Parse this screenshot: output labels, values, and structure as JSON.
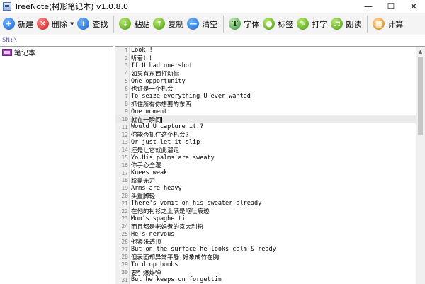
{
  "window": {
    "title": "TreeNote(树形笔记本) v1.0.8.0"
  },
  "toolbar": {
    "new": "新建",
    "delete": "删除",
    "find": "查找",
    "paste": "粘贴",
    "copy": "复制",
    "clear": "清空",
    "font": "字体",
    "tag": "标签",
    "type": "打字",
    "read": "朗读",
    "calc": "计算"
  },
  "path": "SN:\\",
  "tree": {
    "root": "笔记本"
  },
  "editor": {
    "lines": [
      {
        "n": "1",
        "t": "Look !"
      },
      {
        "n": "2",
        "t": "听着！！"
      },
      {
        "n": "3",
        "t": "If U had one shot"
      },
      {
        "n": "4",
        "t": "如果有东西打动你"
      },
      {
        "n": "5",
        "t": "One opportunity"
      },
      {
        "n": "6",
        "t": "也许是一个机会"
      },
      {
        "n": "7",
        "t": "To seize everything U ever wanted"
      },
      {
        "n": "8",
        "t": "抓住所有你想要的东西"
      },
      {
        "n": "9",
        "t": "One moment"
      },
      {
        "n": "10",
        "t": "就在一瞬间"
      },
      {
        "n": "11",
        "t": "Would U capture it ?"
      },
      {
        "n": "12",
        "t": "你能否抓住这个机会?"
      },
      {
        "n": "13",
        "t": "Or just let it slip"
      },
      {
        "n": "14",
        "t": "还是让它就此溜走"
      },
      {
        "n": "15",
        "t": "Yo,His palms are sweaty"
      },
      {
        "n": "16",
        "t": "你手心全湿"
      },
      {
        "n": "17",
        "t": "Knees weak"
      },
      {
        "n": "18",
        "t": "膝盖无力"
      },
      {
        "n": "19",
        "t": "Arms are heavy"
      },
      {
        "n": "20",
        "t": "头重脚轻"
      },
      {
        "n": "21",
        "t": "There's vomit on his sweater already"
      },
      {
        "n": "22",
        "t": "在他的衬衫之上满是呕吐痕迹"
      },
      {
        "n": "23",
        "t": "Mom's spaghetti"
      },
      {
        "n": "24",
        "t": "而且都是老妈煮的意大利粉"
      },
      {
        "n": "25",
        "t": "He's nervous"
      },
      {
        "n": "26",
        "t": "他紧张透顶"
      },
      {
        "n": "27",
        "t": "But on the surface he looks calm & ready"
      },
      {
        "n": "28",
        "t": "但表面却异常平静,好象成竹在胸"
      },
      {
        "n": "29",
        "t": "To drop bombs"
      },
      {
        "n": "30",
        "t": "要引爆炸弹"
      },
      {
        "n": "31",
        "t": "But he keeps on forgettin"
      }
    ]
  }
}
